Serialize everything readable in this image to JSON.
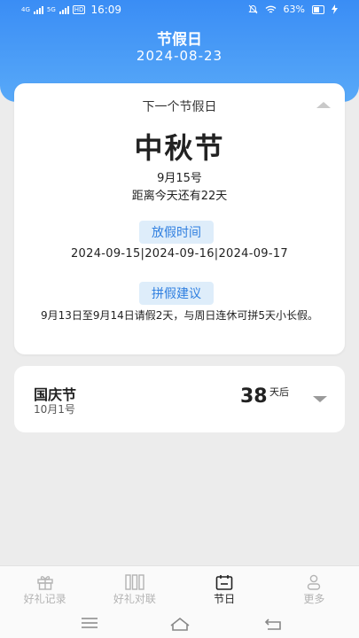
{
  "status": {
    "net": "4G",
    "net2": "5G",
    "hd": "HD",
    "time": "16:09",
    "battery": "63%"
  },
  "header": {
    "title": "节假日",
    "date": "2024-08-23"
  },
  "main_card": {
    "label": "下一个节假日",
    "holiday": "中秋节",
    "date": "9月15号",
    "countdown": "距离今天还有22天",
    "off_tag": "放假时间",
    "off_dates": "2024-09-15|2024-09-16|2024-09-17",
    "advice_tag": "拼假建议",
    "advice": "9月13日至9月14日请假2天，与周日连休可拼5天小长假。"
  },
  "next_card": {
    "holiday": "国庆节",
    "date": "10月1号",
    "days": "38",
    "unit": "天后"
  },
  "tabs": [
    {
      "label": "好礼记录",
      "icon": "gift-icon",
      "active": false
    },
    {
      "label": "好礼对联",
      "icon": "couplet-icon",
      "active": false
    },
    {
      "label": "节日",
      "icon": "calendar-icon",
      "active": true
    },
    {
      "label": "更多",
      "icon": "user-icon",
      "active": false
    }
  ],
  "colors": {
    "accent": "#3a8df5",
    "tag_bg": "#deedfa",
    "tag_text": "#2f7fe0",
    "page_bg": "#ececec"
  }
}
